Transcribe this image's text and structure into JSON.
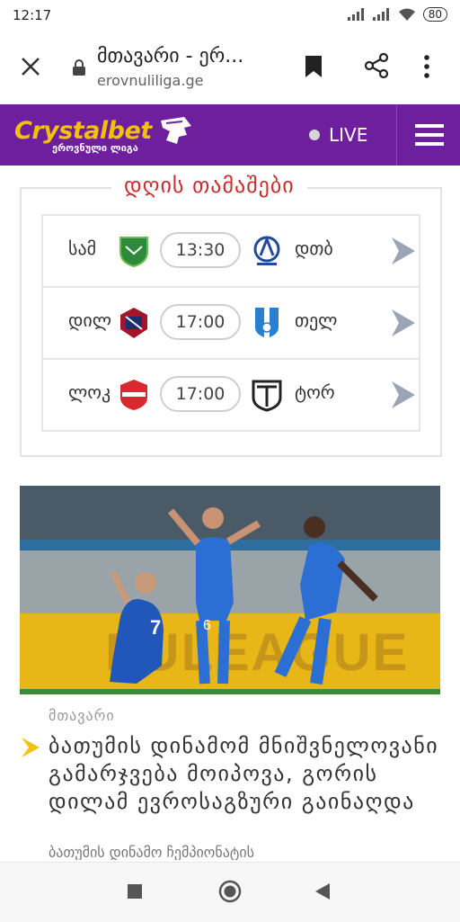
{
  "status_bar": {
    "time": "12:17",
    "battery": "80"
  },
  "browser": {
    "title": "მთავარი - ერ...",
    "url": "erovnuliliga.ge"
  },
  "site_header": {
    "logo_main": "Crystalbet",
    "logo_sub": "ეროვნული ლიგა",
    "live_label": "LIVE"
  },
  "games": {
    "title": "დღის თამაშები",
    "matches": [
      {
        "home": "სამ",
        "time": "13:30",
        "away": "დთბ",
        "home_color": "#2c8a3a",
        "away_color": "#1f4aa0"
      },
      {
        "home": "დილ",
        "time": "17:00",
        "away": "თელ",
        "home_color": "#a3162a",
        "away_color": "#2a7fd0"
      },
      {
        "home": "ლოკ",
        "time": "17:00",
        "away": "ტორ",
        "home_color": "#d9282f",
        "away_color": "#222222"
      }
    ]
  },
  "news": {
    "category": "მთავარი",
    "title": "ბათუმის დინამომ მნიშვნელოვანი გამარჯვება მოიპოვა, გორის დილამ ევროსაგზური გაინაღდა",
    "subtitle": "ბათუმის დინამო ჩემპიონატის",
    "image": {
      "banner_text": "EULEAGUE",
      "jersey_left": "7",
      "jersey_center": "6"
    }
  },
  "colors": {
    "brand_purple": "#6e1f9e",
    "logo_yellow": "#f2c200",
    "title_red": "#cc2c2c",
    "accent_yellow": "#f4c20d"
  }
}
